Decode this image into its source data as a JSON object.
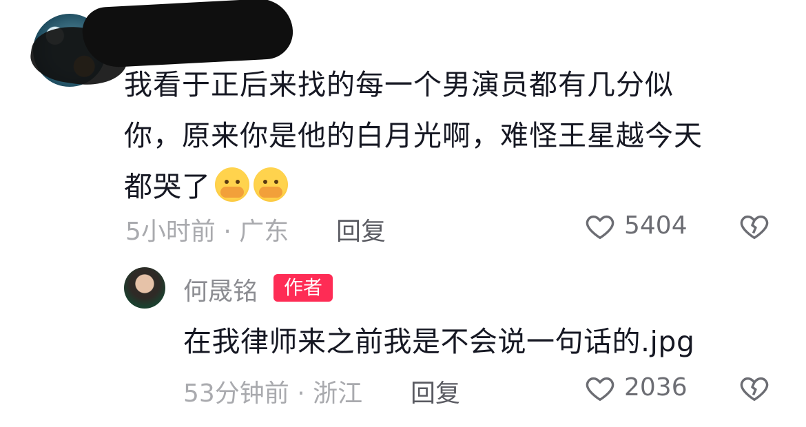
{
  "comment1": {
    "avatar_icon": "avatar",
    "text_line1": "我看于正后来找的每一个男演员都有几分似",
    "text_line2": "你，原来你是他的白月光啊，难怪王星越今天",
    "text_line3": "都哭了",
    "emoji_icons": [
      "crying-emoji",
      "crying-emoji"
    ],
    "meta": "5小时前 · 广东",
    "reply_label": "回复",
    "likes": "5404"
  },
  "reply1": {
    "avatar_icon": "avatar",
    "author_name": "何晟铭",
    "badge": "作者",
    "text": "在我律师来之前我是不会说一句话的.jpg",
    "meta": "53分钟前 · 浙江",
    "reply_label": "回复",
    "likes": "2036"
  },
  "colors": {
    "badge": "#fe2c55",
    "text": "#161823",
    "meta": "#a9aaae"
  }
}
